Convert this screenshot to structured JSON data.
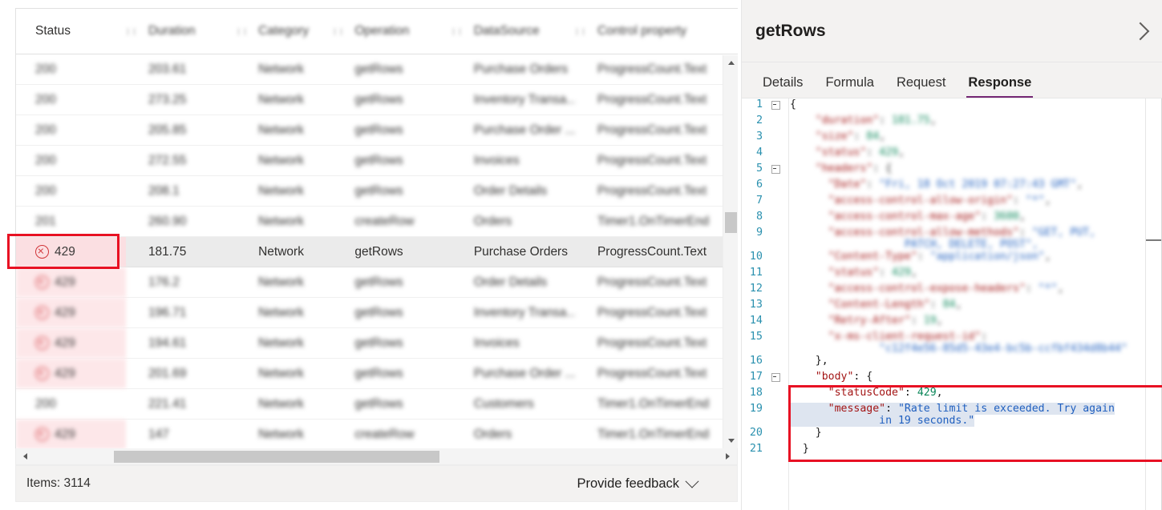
{
  "table": {
    "columns": [
      {
        "key": "status",
        "label": "Status",
        "blurred": false
      },
      {
        "key": "duration",
        "label": "Duration",
        "blurred": true
      },
      {
        "key": "category",
        "label": "Category",
        "blurred": true
      },
      {
        "key": "operation",
        "label": "Operation",
        "blurred": true
      },
      {
        "key": "datasource",
        "label": "DataSource",
        "blurred": true
      },
      {
        "key": "control",
        "label": "Control property",
        "blurred": true
      }
    ],
    "rows": [
      {
        "status": "200",
        "duration": "203.61",
        "category": "Network",
        "operation": "getRows",
        "datasource": "Purchase Orders",
        "control": "ProgressCount.Text",
        "error": false,
        "selected": false,
        "blurred": true
      },
      {
        "status": "200",
        "duration": "273.25",
        "category": "Network",
        "operation": "getRows",
        "datasource": "Inventory Transa...",
        "control": "ProgressCount.Text",
        "error": false,
        "selected": false,
        "blurred": true
      },
      {
        "status": "200",
        "duration": "205.85",
        "category": "Network",
        "operation": "getRows",
        "datasource": "Purchase Order ...",
        "control": "ProgressCount.Text",
        "error": false,
        "selected": false,
        "blurred": true
      },
      {
        "status": "200",
        "duration": "272.55",
        "category": "Network",
        "operation": "getRows",
        "datasource": "Invoices",
        "control": "ProgressCount.Text",
        "error": false,
        "selected": false,
        "blurred": true
      },
      {
        "status": "200",
        "duration": "208.1",
        "category": "Network",
        "operation": "getRows",
        "datasource": "Order Details",
        "control": "ProgressCount.Text",
        "error": false,
        "selected": false,
        "blurred": true
      },
      {
        "status": "201",
        "duration": "260.90",
        "category": "Network",
        "operation": "createRow",
        "datasource": "Orders",
        "control": "Timer1.OnTimerEnd",
        "error": false,
        "selected": false,
        "blurred": true
      },
      {
        "status": "429",
        "duration": "181.75",
        "category": "Network",
        "operation": "getRows",
        "datasource": "Purchase Orders",
        "control": "ProgressCount.Text",
        "error": true,
        "selected": true,
        "blurred": false
      },
      {
        "status": "429",
        "duration": "176.2",
        "category": "Network",
        "operation": "getRows",
        "datasource": "Order Details",
        "control": "ProgressCount.Text",
        "error": true,
        "selected": false,
        "blurred": true
      },
      {
        "status": "429",
        "duration": "196.71",
        "category": "Network",
        "operation": "getRows",
        "datasource": "Inventory Transa...",
        "control": "ProgressCount.Text",
        "error": true,
        "selected": false,
        "blurred": true
      },
      {
        "status": "429",
        "duration": "194.61",
        "category": "Network",
        "operation": "getRows",
        "datasource": "Invoices",
        "control": "ProgressCount.Text",
        "error": true,
        "selected": false,
        "blurred": true
      },
      {
        "status": "429",
        "duration": "201.69",
        "category": "Network",
        "operation": "getRows",
        "datasource": "Purchase Order ...",
        "control": "ProgressCount.Text",
        "error": true,
        "selected": false,
        "blurred": true
      },
      {
        "status": "200",
        "duration": "221.41",
        "category": "Network",
        "operation": "getRows",
        "datasource": "Customers",
        "control": "Timer1.OnTimerEnd",
        "error": false,
        "selected": false,
        "blurred": true
      },
      {
        "status": "429",
        "duration": "147",
        "category": "Network",
        "operation": "createRow",
        "datasource": "Orders",
        "control": "Timer1.OnTimerEnd",
        "error": true,
        "selected": false,
        "blurred": true
      }
    ]
  },
  "statusbar": {
    "items_label": "Items: 3114",
    "feedback_label": "Provide feedback"
  },
  "detail": {
    "title": "getRows",
    "tabs": [
      {
        "label": "Details",
        "active": false
      },
      {
        "label": "Formula",
        "active": false
      },
      {
        "label": "Request",
        "active": false
      },
      {
        "label": "Response",
        "active": true
      }
    ],
    "accent_color": "#742774"
  },
  "code": {
    "lines": [
      {
        "no": "1",
        "fold": true,
        "blurred": false,
        "segments": [
          {
            "t": "{",
            "c": "p"
          }
        ]
      },
      {
        "no": "2",
        "fold": false,
        "blurred": true,
        "segments": [
          {
            "t": "    \"duration\"",
            "c": "k"
          },
          {
            "t": ": ",
            "c": "p"
          },
          {
            "t": "181.75",
            "c": "n"
          },
          {
            "t": ",",
            "c": "p"
          }
        ]
      },
      {
        "no": "3",
        "fold": false,
        "blurred": true,
        "segments": [
          {
            "t": "    \"size\"",
            "c": "k"
          },
          {
            "t": ": ",
            "c": "p"
          },
          {
            "t": "84",
            "c": "n"
          },
          {
            "t": ",",
            "c": "p"
          }
        ]
      },
      {
        "no": "4",
        "fold": false,
        "blurred": true,
        "segments": [
          {
            "t": "    \"status\"",
            "c": "k"
          },
          {
            "t": ": ",
            "c": "p"
          },
          {
            "t": "429",
            "c": "n"
          },
          {
            "t": ",",
            "c": "p"
          }
        ]
      },
      {
        "no": "5",
        "fold": true,
        "blurred": true,
        "segments": [
          {
            "t": "    \"headers\"",
            "c": "k"
          },
          {
            "t": ": {",
            "c": "p"
          }
        ]
      },
      {
        "no": "6",
        "fold": false,
        "blurred": true,
        "segments": [
          {
            "t": "      \"Date\"",
            "c": "k"
          },
          {
            "t": ": ",
            "c": "p"
          },
          {
            "t": "\"Fri, 18 Oct 2019 07:27:43 GMT\"",
            "c": "s"
          },
          {
            "t": ",",
            "c": "p"
          }
        ]
      },
      {
        "no": "7",
        "fold": false,
        "blurred": true,
        "segments": [
          {
            "t": "      \"access-control-allow-origin\"",
            "c": "k"
          },
          {
            "t": ": ",
            "c": "p"
          },
          {
            "t": "\"*\"",
            "c": "s"
          },
          {
            "t": ",",
            "c": "p"
          }
        ]
      },
      {
        "no": "8",
        "fold": false,
        "blurred": true,
        "segments": [
          {
            "t": "      \"access-control-max-age\"",
            "c": "k"
          },
          {
            "t": ": ",
            "c": "p"
          },
          {
            "t": "3600",
            "c": "n"
          },
          {
            "t": ",",
            "c": "p"
          }
        ]
      },
      {
        "no": "9",
        "fold": false,
        "blurred": true,
        "wrap": "                  PATCH, DELETE, POST\",",
        "segments": [
          {
            "t": "      \"access-control-allow-methods\"",
            "c": "k"
          },
          {
            "t": ": ",
            "c": "p"
          },
          {
            "t": "\"GET, PUT,",
            "c": "s"
          }
        ]
      },
      {
        "no": "10",
        "fold": false,
        "blurred": true,
        "segments": [
          {
            "t": "      \"Content-Type\"",
            "c": "k"
          },
          {
            "t": ": ",
            "c": "p"
          },
          {
            "t": "\"application/json\"",
            "c": "s"
          },
          {
            "t": ",",
            "c": "p"
          }
        ]
      },
      {
        "no": "11",
        "fold": false,
        "blurred": true,
        "segments": [
          {
            "t": "      \"status\"",
            "c": "k"
          },
          {
            "t": ": ",
            "c": "p"
          },
          {
            "t": "429",
            "c": "n"
          },
          {
            "t": ",",
            "c": "p"
          }
        ]
      },
      {
        "no": "12",
        "fold": false,
        "blurred": true,
        "segments": [
          {
            "t": "      \"access-control-expose-headers\"",
            "c": "k"
          },
          {
            "t": ": ",
            "c": "p"
          },
          {
            "t": "\"*\"",
            "c": "s"
          },
          {
            "t": ",",
            "c": "p"
          }
        ]
      },
      {
        "no": "13",
        "fold": false,
        "blurred": true,
        "segments": [
          {
            "t": "      \"Content-Length\"",
            "c": "k"
          },
          {
            "t": ": ",
            "c": "p"
          },
          {
            "t": "84",
            "c": "n"
          },
          {
            "t": ",",
            "c": "p"
          }
        ]
      },
      {
        "no": "14",
        "fold": false,
        "blurred": true,
        "segments": [
          {
            "t": "      \"Retry-After\"",
            "c": "k"
          },
          {
            "t": ": ",
            "c": "p"
          },
          {
            "t": "19",
            "c": "n"
          },
          {
            "t": ",",
            "c": "p"
          }
        ]
      },
      {
        "no": "15",
        "fold": false,
        "blurred": true,
        "wrap": "              \"c12f4e56-85d5-43e4-bc5b-ccfbf434d8b44\"",
        "segments": [
          {
            "t": "      \"x-ms-client-request-id\"",
            "c": "k"
          },
          {
            "t": ":",
            "c": "p"
          }
        ]
      },
      {
        "no": "16",
        "fold": false,
        "blurred": false,
        "segments": [
          {
            "t": "    },",
            "c": "p"
          }
        ]
      },
      {
        "no": "17",
        "fold": true,
        "blurred": false,
        "segments": [
          {
            "t": "    \"body\"",
            "c": "k"
          },
          {
            "t": ": {",
            "c": "p"
          }
        ]
      },
      {
        "no": "18",
        "fold": false,
        "blurred": false,
        "segments": [
          {
            "t": "      \"statusCode\"",
            "c": "k"
          },
          {
            "t": ": ",
            "c": "p"
          },
          {
            "t": "429",
            "c": "n"
          },
          {
            "t": ",",
            "c": "p"
          }
        ]
      },
      {
        "no": "19",
        "fold": false,
        "blurred": false,
        "selected": true,
        "wrap": "              in 19 seconds.\"",
        "segments": [
          {
            "t": "      \"message\"",
            "c": "k"
          },
          {
            "t": ": ",
            "c": "p"
          },
          {
            "t": "\"Rate limit is exceeded. Try again",
            "c": "s"
          }
        ]
      },
      {
        "no": "20",
        "fold": false,
        "blurred": false,
        "segments": [
          {
            "t": "    }",
            "c": "p"
          }
        ]
      },
      {
        "no": "21",
        "fold": false,
        "blurred": false,
        "segments": [
          {
            "t": "  }",
            "c": "p"
          }
        ]
      }
    ]
  },
  "icons": {
    "error": "error-circle-x-icon",
    "expand": "chevron-right-icon",
    "feedback": "chevron-down-icon",
    "scroll_up": "scroll-up-arrow-icon",
    "scroll_down": "scroll-down-arrow-icon",
    "scroll_left": "scroll-left-arrow-icon",
    "scroll_right": "scroll-right-arrow-icon"
  }
}
